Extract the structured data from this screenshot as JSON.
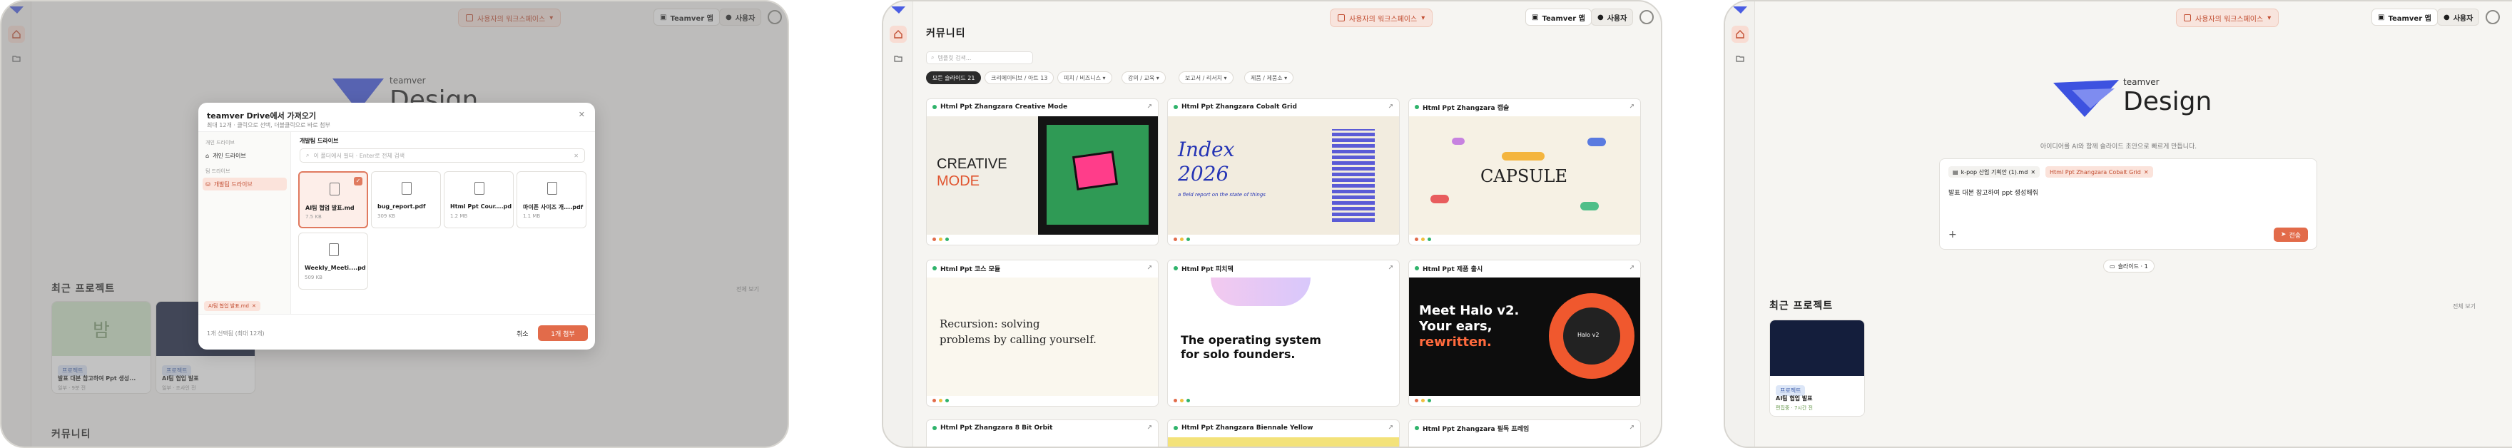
{
  "workspace_label": "사용자의 워크스페이스",
  "top_buttons": {
    "teamver": "Teamver 앱",
    "user": "사용자"
  },
  "community_title": "커뮤니티",
  "recent_title": "최근 프로젝트",
  "view_all": "전체 보기",
  "brand": {
    "small": "teamver",
    "big": "Design"
  },
  "modal": {
    "title": "teamver Drive에서 가져오기",
    "subtitle": "최대 12개 · 클릭으로 선택, 더블클릭으로 바로 첨부",
    "left_heading_1": "개인 드라이브",
    "left_item_1": "개인 드라이브",
    "left_heading_2": "팀 드라이브",
    "left_item_2": "개발팀 드라이브",
    "breadcrumb": "개발팀 드라이브",
    "search_placeholder": "이 폴더에서 필터 · Enter로 전체 검색",
    "files": [
      {
        "name": "AI팀 협업 발표.md",
        "size": "7.5 KB",
        "selected": true
      },
      {
        "name": "bug_report.pdf",
        "size": "309 KB",
        "selected": false
      },
      {
        "name": "Html Ppt Cour....pdf",
        "size": "1.2 MB",
        "selected": false
      },
      {
        "name": "마이픈 사이즈 개....pdf",
        "size": "1.1 MB",
        "selected": false
      },
      {
        "name": "Weekly_Meeti....pdf",
        "size": "509 KB",
        "selected": false
      }
    ],
    "attached_chip": "AI팀 협업 발표.md",
    "footer_note": "1개 선택됨 (최대 12개)",
    "cancel": "취소",
    "confirm": "1개 첨부"
  },
  "recent_projects_left": [
    {
      "title": "발표 대본 참고하여 Ppt 생성...",
      "tag": "프로젝트",
      "meta": "일부 · 9분 전",
      "thumb_text": "밤"
    },
    {
      "title": "AI팀 협업 발표",
      "tag": "프로젝트",
      "meta": "일부 · 조사인 전"
    }
  ],
  "search_placeholder_community": "템플릿 검색...",
  "chips": [
    {
      "label": "모든 슬라이드 21",
      "on": true
    },
    {
      "label": "크리에이티브 / 아트 13",
      "on": false
    },
    {
      "label": "피치 / 비즈니스 ▾",
      "on": false
    },
    {
      "label": "강의 / 교육 ▾",
      "on": false
    },
    {
      "label": "보고서 / 리서치 ▾",
      "on": false
    },
    {
      "label": "제품 / 제품소 ▾",
      "on": false
    }
  ],
  "templates": [
    {
      "name": "Html Ppt Zhangzara Creative Mode"
    },
    {
      "name": "Html Ppt Zhangzara Cobalt Grid"
    },
    {
      "name": "Html Ppt Zhangzara 캡슐"
    },
    {
      "name": "Html Ppt 코스 모듈"
    },
    {
      "name": "Html Ppt 피치덱"
    },
    {
      "name": "Html Ppt 제품 출시"
    },
    {
      "name": "Html Ppt Zhangzara 8 Bit Orbit"
    },
    {
      "name": "Html Ppt Zhangzara Biennale Yellow"
    },
    {
      "name": "Html Ppt Zhangzara 필독 프레임"
    }
  ],
  "thumb_texts": {
    "creative": [
      "CREATIVE",
      "MODE"
    ],
    "index": [
      "Index",
      "2026"
    ],
    "index_sub": "a field report on the state of things",
    "capsule": "CAPSULE",
    "recursion": [
      "Recursion: solving",
      "problems by calling yourself."
    ],
    "operating": [
      "The operating system",
      "for solo founders."
    ],
    "halo": [
      "Meet Halo v2.",
      "Your ears,",
      "rewritten."
    ],
    "halo_badge": "Halo v2"
  },
  "composer": {
    "hint": "아이디어를 AI와 함께 슬라이드 초안으로 빠르게 만듭니다.",
    "file_chip": "k-pop 산업 기획안 (1).md",
    "template_chip": "Html Ppt Zhangzara Cobalt Grid",
    "text": "발표 대본 참고하여 ppt 생성해줘",
    "send": "전송",
    "slide_btn": "슬라이드 · 1"
  },
  "recent_projects_right": [
    {
      "title": "AI팀 협업 발표",
      "tag": "프로젝트",
      "meta": "편집중 · 7시간 전"
    }
  ],
  "colors": {
    "accent": "#e26b4a",
    "ws_bg": "#f8e4dd",
    "brand_blue": "#3d52e0"
  }
}
